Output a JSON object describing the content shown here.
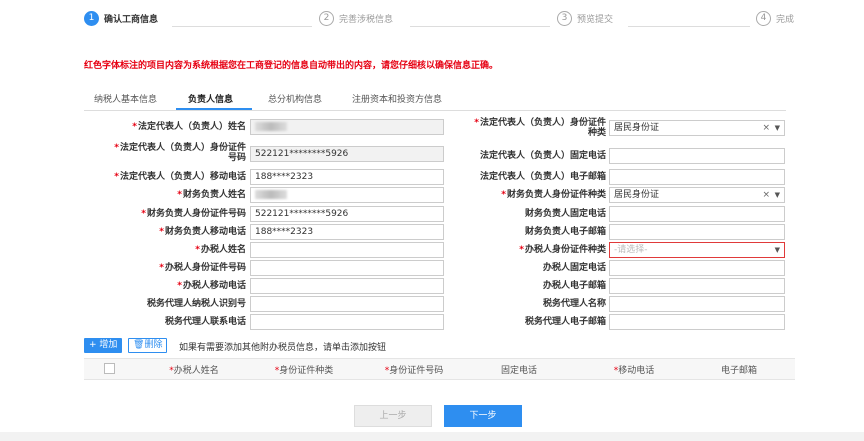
{
  "steps": [
    {
      "num": "1",
      "label": "确认工商信息"
    },
    {
      "num": "2",
      "label": "完善涉税信息"
    },
    {
      "num": "3",
      "label": "预览提交"
    },
    {
      "num": "4",
      "label": "完成"
    }
  ],
  "notice": "红色字体标注的项目内容为系统根据您在工商登记的信息自动带出的内容，请您仔细核以确保信息正确。",
  "tabs": [
    "纳税人基本信息",
    "负责人信息",
    "总分机构信息",
    "注册资本和投资方信息"
  ],
  "form": {
    "left": [
      {
        "label": "法定代表人（负责人）姓名",
        "required": true,
        "value": ""
      },
      {
        "label1": "法定代表人（负责人）身份证件",
        "label2": "号码",
        "required": true,
        "value": "522121********5926"
      },
      {
        "label": "法定代表人（负责人）移动电话",
        "required": true,
        "value": "188****2323"
      },
      {
        "label": "财务负责人姓名",
        "required": true,
        "value": ""
      },
      {
        "label": "财务负责人身份证件号码",
        "required": true,
        "value": "522121********5926"
      },
      {
        "label": "财务负责人移动电话",
        "required": true,
        "value": "188****2323"
      },
      {
        "label": "办税人姓名",
        "required": true,
        "value": ""
      },
      {
        "label": "办税人身份证件号码",
        "required": true,
        "value": ""
      },
      {
        "label": "办税人移动电话",
        "required": true,
        "value": ""
      },
      {
        "label": "税务代理人纳税人识别号",
        "required": false,
        "value": ""
      },
      {
        "label": "税务代理人联系电话",
        "required": false,
        "value": ""
      }
    ],
    "right": [
      {
        "label1": "法定代表人（负责人）身份证件",
        "label2": "种类",
        "required": true,
        "value": "居民身份证",
        "type": "select"
      },
      {
        "label": "法定代表人（负责人）固定电话",
        "required": false,
        "value": ""
      },
      {
        "label": "法定代表人（负责人）电子邮箱",
        "required": false,
        "value": ""
      },
      {
        "label": "财务负责人身份证件种类",
        "required": true,
        "value": "居民身份证",
        "type": "select"
      },
      {
        "label": "财务负责人固定电话",
        "required": false,
        "value": ""
      },
      {
        "label": "财务负责人电子邮箱",
        "required": false,
        "value": ""
      },
      {
        "label": "办税人身份证件种类",
        "required": true,
        "placeholder": "-请选择-",
        "type": "select"
      },
      {
        "label": "办税人固定电话",
        "required": false,
        "value": ""
      },
      {
        "label": "办税人电子邮箱",
        "required": false,
        "value": ""
      },
      {
        "label": "税务代理人名称",
        "required": false,
        "value": ""
      },
      {
        "label": "税务代理人电子邮箱",
        "required": false,
        "value": ""
      }
    ]
  },
  "actions": {
    "add": "增加",
    "delete": "删除",
    "tip": "如果有需要添加其他附办税员信息，请单击添加按钮"
  },
  "table_headers": [
    {
      "label": "办税人姓名",
      "required": true
    },
    {
      "label": "身份证件种类",
      "required": true
    },
    {
      "label": "身份证件号码",
      "required": true
    },
    {
      "label": "固定电话",
      "required": false
    },
    {
      "label": "移动电话",
      "required": true
    },
    {
      "label": "电子邮箱",
      "required": false
    }
  ],
  "nav": {
    "prev": "上一步",
    "next": "下一步"
  },
  "colors": {
    "accent": "#2e8ef0",
    "required": "#e60012"
  }
}
